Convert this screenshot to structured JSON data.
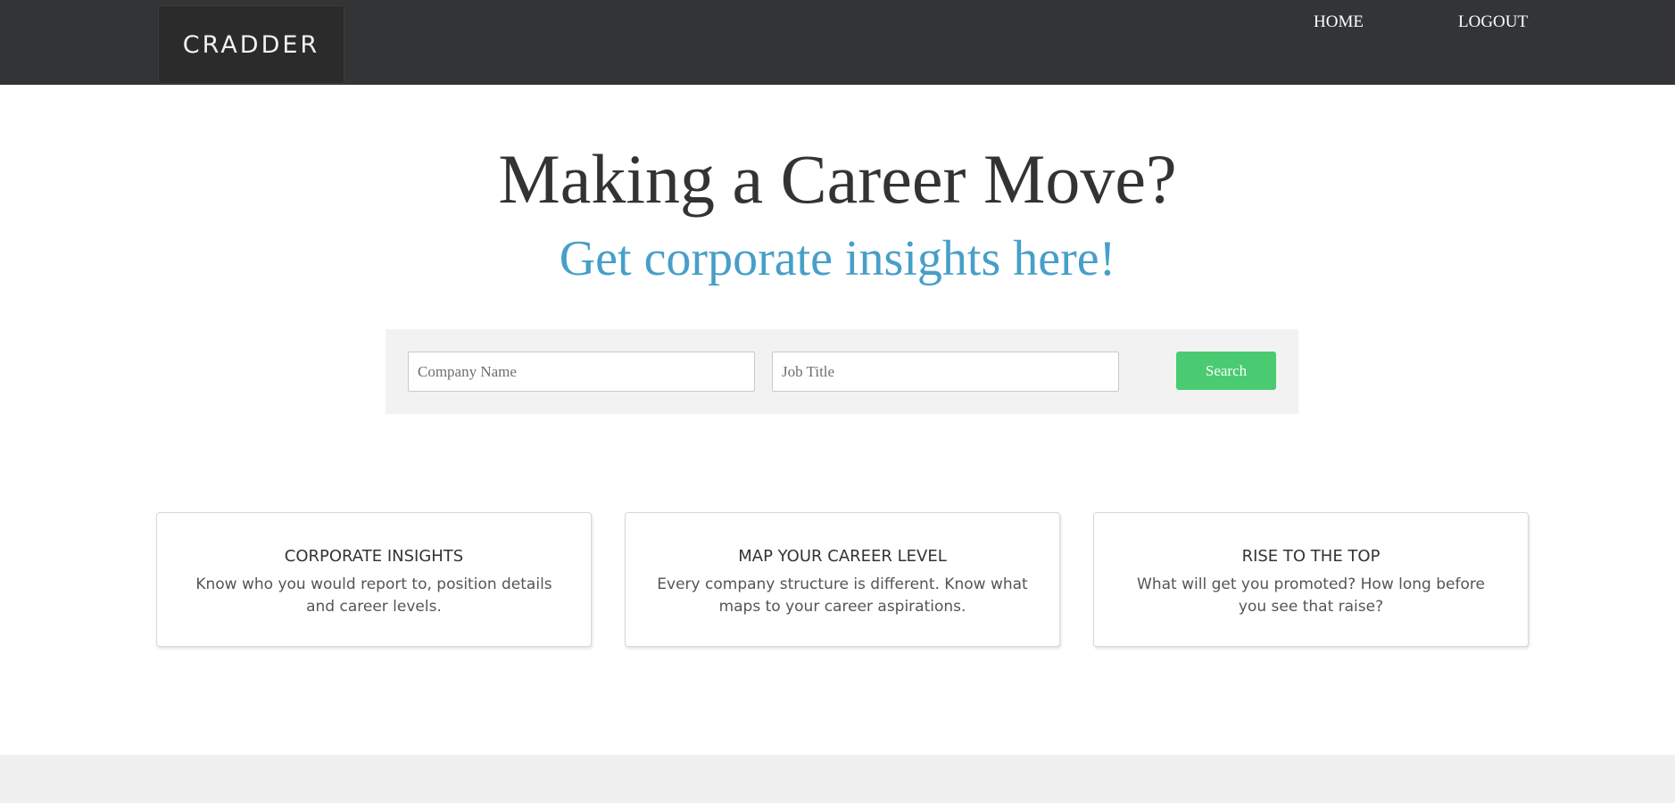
{
  "header": {
    "logo_text": "CRADDER",
    "nav": {
      "home_label": "HOME",
      "logout_label": "LOGOUT"
    }
  },
  "hero": {
    "title": "Making a Career Move?",
    "subtitle": "Get corporate insights here!"
  },
  "search": {
    "company_placeholder": "Company Name",
    "company_value": "",
    "job_title_placeholder": "Job Title",
    "job_title_value": "",
    "button_label": "Search"
  },
  "features": [
    {
      "title": "CORPORATE INSIGHTS",
      "text": "Know who you would report to, position details and career levels."
    },
    {
      "title": "MAP YOUR CAREER LEVEL",
      "text": "Every company structure is different. Know what maps to your career aspirations."
    },
    {
      "title": "RISE TO THE TOP",
      "text": "What will get you promoted? How long before you see that raise?"
    }
  ],
  "colors": {
    "navbar_bg": "#333436",
    "subtitle": "#479fc8",
    "search_button": "#4acb72",
    "panel_bg": "#f2f2f2"
  }
}
